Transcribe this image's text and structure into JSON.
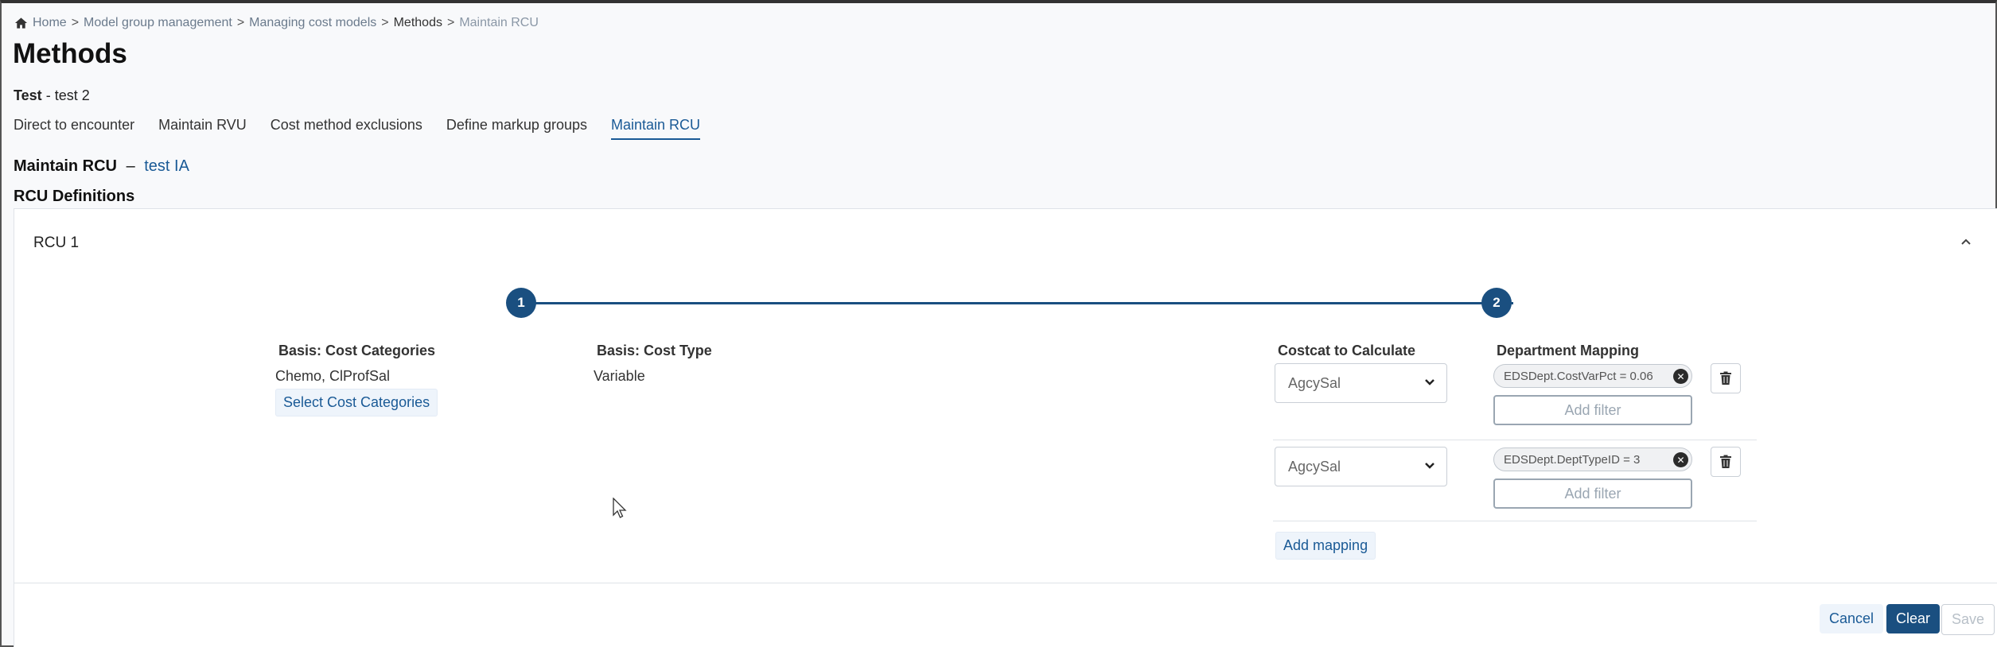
{
  "breadcrumb": {
    "home": "Home",
    "sep": ">",
    "items": [
      "Model group management",
      "Managing cost models",
      "Methods",
      "Maintain RCU"
    ]
  },
  "page": {
    "title": "Methods",
    "model_name": "Test",
    "model_suffix": "- test 2"
  },
  "tabs": [
    {
      "label": "Direct to encounter"
    },
    {
      "label": "Maintain RVU"
    },
    {
      "label": "Cost method exclusions"
    },
    {
      "label": "Define markup groups"
    },
    {
      "label": "Maintain RCU",
      "active": true
    }
  ],
  "section": {
    "title": "Maintain RCU",
    "dash": "–",
    "subtitle": "test IA",
    "definitions_title": "RCU Definitions"
  },
  "rcu": {
    "header": "RCU 1",
    "steps": [
      "1",
      "2"
    ],
    "basis_cost_categories": {
      "label": "Basis: Cost Categories",
      "value": "Chemo, ClProfSal",
      "select_button": "Select Cost Categories"
    },
    "basis_cost_type": {
      "label": "Basis: Cost Type",
      "value": "Variable"
    },
    "costcat_label": "Costcat to Calculate",
    "dept_mapping_label": "Department Mapping",
    "mappings": [
      {
        "costcat": "AgcySal",
        "filter": "EDSDept.CostVarPct = 0.06",
        "add_filter": "Add filter"
      },
      {
        "costcat": "AgcySal",
        "filter": "EDSDept.DeptTypeID = 3",
        "add_filter": "Add filter"
      }
    ],
    "add_mapping": "Add mapping"
  },
  "footer": {
    "cancel": "Cancel",
    "clear": "Clear",
    "save": "Save"
  },
  "colors": {
    "primary": "#1a4f80",
    "link": "#1a5a96",
    "background": "#f8f9fb"
  },
  "icons": {
    "home": "home-icon",
    "collapse": "chevron-up-icon",
    "select": "chevron-down-icon",
    "remove_filter": "close-circle-icon",
    "delete": "trash-icon",
    "cursor": "mouse-pointer-icon"
  }
}
